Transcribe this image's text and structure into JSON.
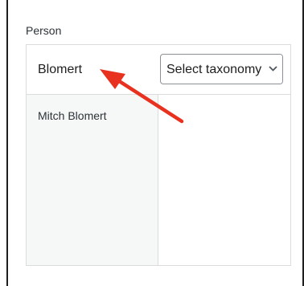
{
  "field": {
    "label": "Person"
  },
  "search": {
    "value": "Blomert"
  },
  "taxonomy_select": {
    "selected": "Select taxonomy"
  },
  "results": {
    "items": [
      "Mitch Blomert"
    ]
  },
  "annotation": {
    "icon": "red-arrow-icon",
    "color": "#e8311e"
  }
}
